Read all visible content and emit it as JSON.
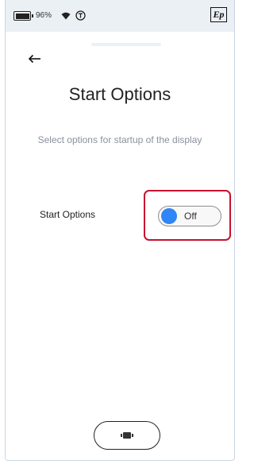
{
  "status_bar": {
    "battery_percent": "96%",
    "battery_level": 0.96,
    "icons": [
      "battery-icon",
      "wifi-icon",
      "alert-circle-icon"
    ],
    "brand_logo_text": "Ep"
  },
  "header": {
    "back_icon": "arrow-left-icon"
  },
  "page": {
    "title": "Start Options",
    "subtitle": "Select options for startup of the display"
  },
  "options": {
    "start_options": {
      "label": "Start Options",
      "state_text": "Off",
      "knob_color": "#2f86f6"
    }
  },
  "colors": {
    "highlight": "#c8102e",
    "status_bar_bg": "#ebf0f5",
    "subtitle_text": "#8b919c"
  }
}
